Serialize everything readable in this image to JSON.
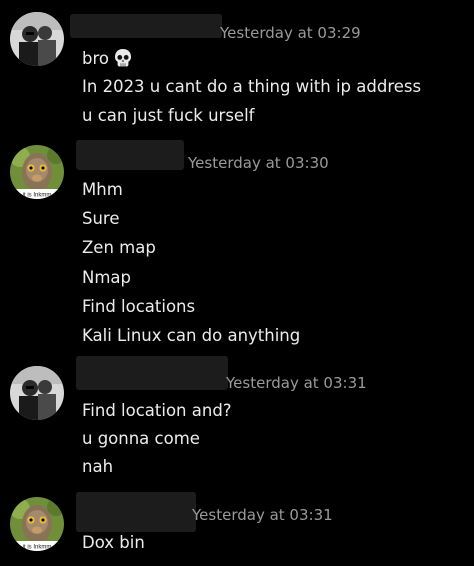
{
  "messages": [
    {
      "avatar": "bw-duo-photo-avatar",
      "timestamp": "Yesterday at 03:29",
      "lines": [
        "bro",
        "In 2023 u cant do a thing with ip address",
        "u can just fuck urself"
      ],
      "emoji": "skull-icon"
    },
    {
      "avatar": "ostrich-avatar",
      "avatar_caption": "it is Inkmm",
      "timestamp": "Yesterday at 03:30",
      "lines": [
        "Mhm",
        "Sure",
        "Zen map",
        "Nmap",
        "Find locations",
        "Kali Linux can  do anything"
      ]
    },
    {
      "avatar": "bw-duo-photo-avatar",
      "timestamp": "Yesterday at 03:31",
      "lines": [
        "Find location and?",
        "u gonna come",
        "nah"
      ]
    },
    {
      "avatar": "ostrich-avatar",
      "avatar_caption": "it is Inkmm",
      "timestamp": "Yesterday at 03:31",
      "lines": [
        "Dox bin"
      ]
    }
  ],
  "colors": {
    "background": "#000000",
    "text": "#ececec",
    "timestamp": "#9a9a9a",
    "redaction": "#1c1c1c"
  }
}
